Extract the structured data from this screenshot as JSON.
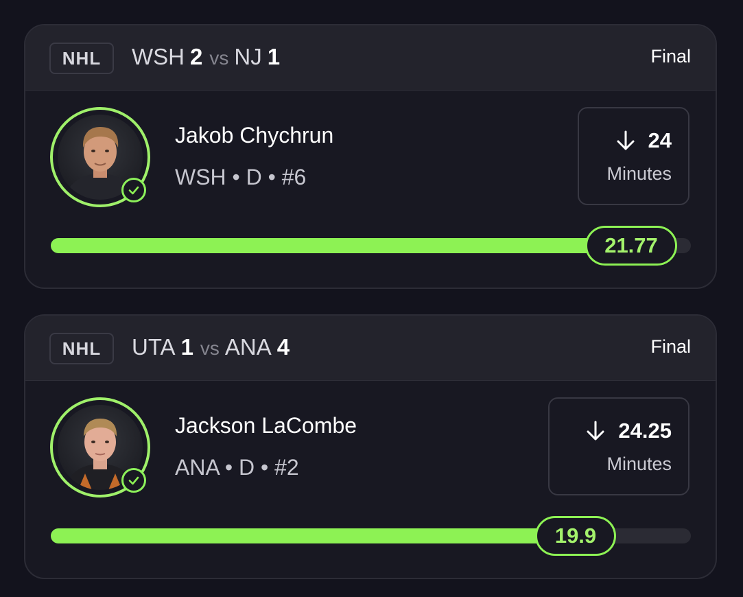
{
  "cards": [
    {
      "league": "NHL",
      "team_a": "WSH",
      "score_a": "2",
      "vs": "vs",
      "team_b": "NJ",
      "score_b": "1",
      "status": "Final",
      "player_name": "Jakob Chychrun",
      "player_info": "WSH • D • #6",
      "stat_value": "24",
      "stat_label": "Minutes",
      "progress_value": "21.77",
      "progress_fraction": 0.907,
      "direction_icon": "arrow-down-icon",
      "check_icon": "check-circle-icon"
    },
    {
      "league": "NHL",
      "team_a": "UTA",
      "score_a": "1",
      "vs": "vs",
      "team_b": "ANA",
      "score_b": "4",
      "status": "Final",
      "player_name": "Jackson LaCombe",
      "player_info": "ANA • D • #2",
      "stat_value": "24.25",
      "stat_label": "Minutes",
      "progress_value": "19.9",
      "progress_fraction": 0.821,
      "direction_icon": "arrow-down-icon",
      "check_icon": "check-circle-icon"
    }
  ],
  "colors": {
    "accent": "#8df254",
    "background": "#13131d",
    "card": "#181822",
    "header": "#23232c"
  }
}
